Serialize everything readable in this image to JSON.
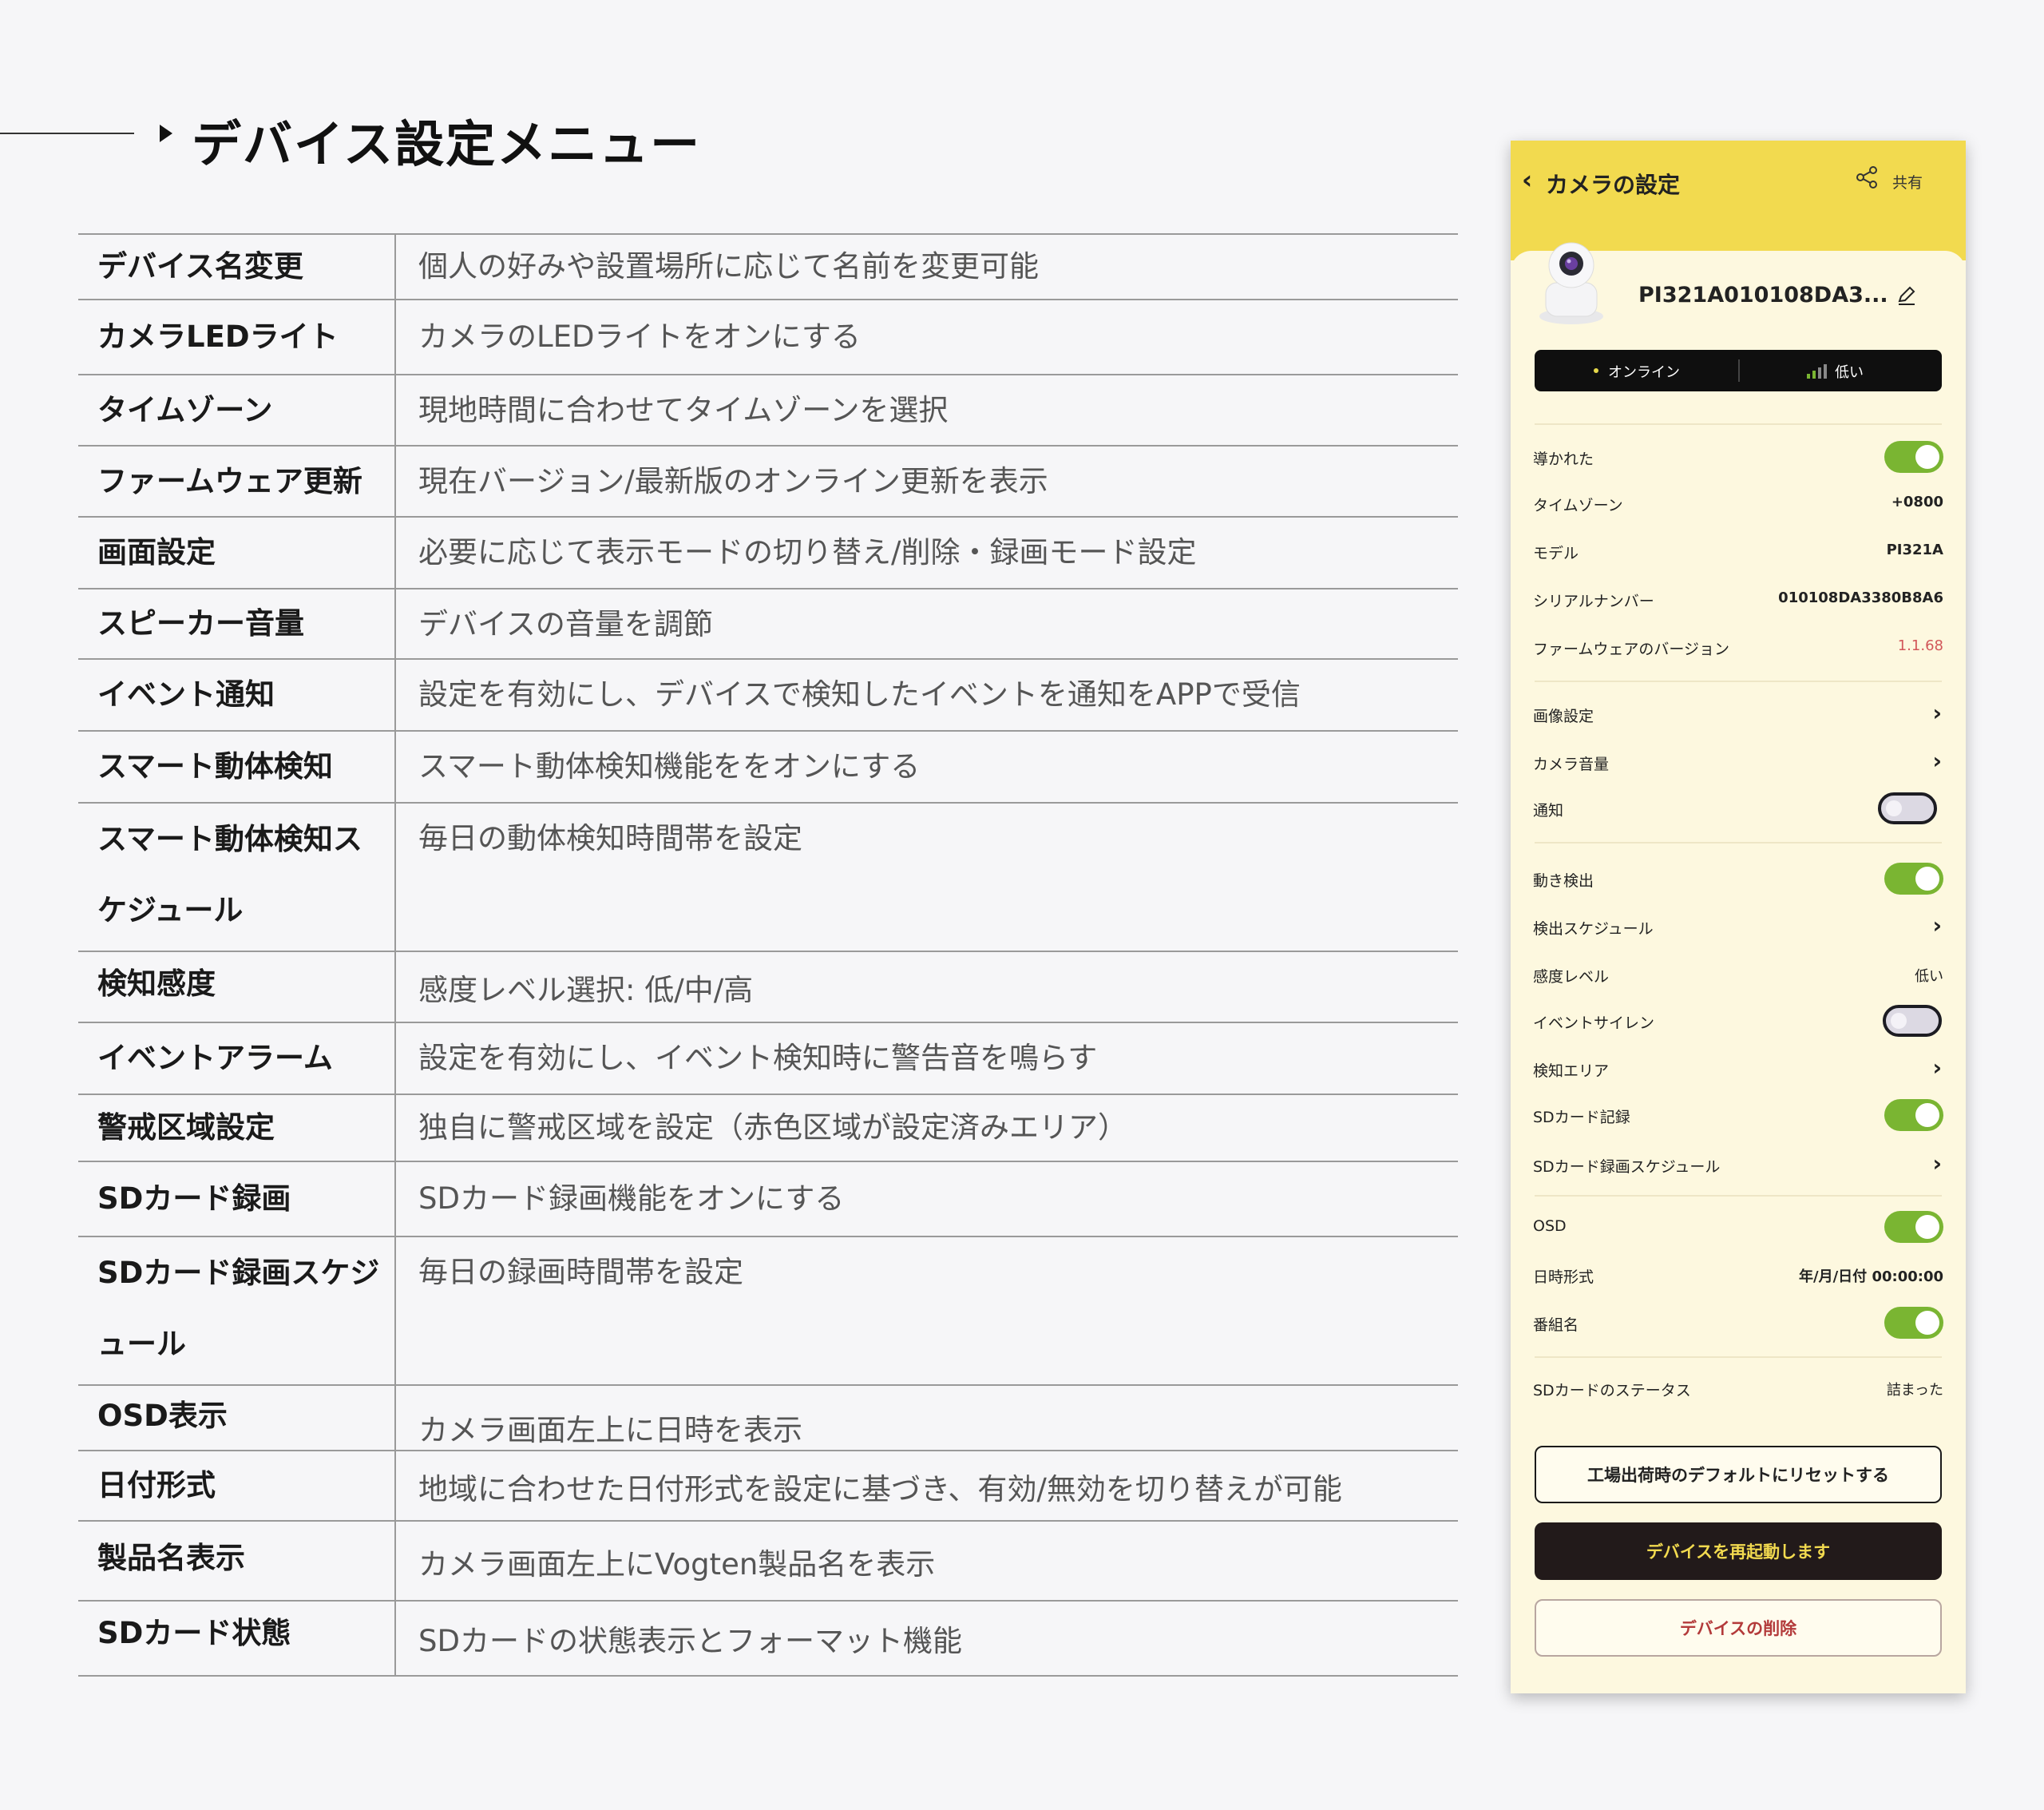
{
  "page_title": "デバイス設定メニュー",
  "table": [
    {
      "name": "デバイス名変更",
      "desc": "個人の好みや設置場所に応じて名前を変更可能"
    },
    {
      "name": "カメラLEDライト",
      "desc": "カメラのLEDライトをオンにする"
    },
    {
      "name": "タイムゾーン",
      "desc": "現地時間に合わせてタイムゾーンを選択"
    },
    {
      "name": "ファームウェア更新",
      "desc": "現在バージョン/最新版のオンライン更新を表示"
    },
    {
      "name": "画面設定",
      "desc": "必要に応じて表示モードの切り替え/削除・録画モード設定"
    },
    {
      "name": "スピーカー音量",
      "desc": "デバイスの音量を調節"
    },
    {
      "name": "イベント通知",
      "desc": "設定を有効にし、デバイスで検知したイベントを通知をAPPで受信"
    },
    {
      "name": "スマート動体検知",
      "desc": "スマート動体検知機能ををオンにする"
    },
    {
      "name_l1": "スマート動体検知ス",
      "name_l2": "ケジュール",
      "desc": "毎日の動体検知時間帯を設定"
    },
    {
      "name": "検知感度",
      "desc": "感度レベル選択: 低/中/高"
    },
    {
      "name": "イベントアラーム",
      "desc": "設定を有効にし、イベント検知時に警告音を鳴らす"
    },
    {
      "name": "警戒区域設定",
      "desc": "独自に警戒区域を設定（赤色区域が設定済みエリア）"
    },
    {
      "name": "SDカード録画",
      "desc": "SDカード録画機能をオンにする"
    },
    {
      "name_l1": "SDカード録画スケジ",
      "name_l2": "ュール",
      "desc": "毎日の録画時間帯を設定"
    },
    {
      "name": "OSD表示",
      "desc": "カメラ画面左上に日時を表示"
    },
    {
      "name": "日付形式",
      "desc": "地域に合わせた日付形式を設定に基づき、有効/無効を切り替えが可能"
    },
    {
      "name": "製品名表示",
      "desc": "カメラ画面左上にVogten製品名を表示"
    },
    {
      "name": "SDカード状態",
      "desc": "SDカードの状態表示とフォーマット機能"
    }
  ],
  "phone": {
    "title": "カメラの設定",
    "back_icon": "chevron-left-icon",
    "share_label": "共有",
    "device_name": "PI321A010108DA3...",
    "status_online": "オンライン",
    "signal_label": "低い",
    "rows": [
      {
        "label": "導かれた",
        "toggle": true
      },
      {
        "label": "タイムゾーン",
        "value": "+0800"
      },
      {
        "label": "モデル",
        "value": "PI321A"
      },
      {
        "label": "シリアルナンバー",
        "value": "010108DA3380B8A6"
      },
      {
        "label": "ファームウェアのバージョン",
        "value": "1.1.68"
      },
      {
        "label": "画像設定"
      },
      {
        "label": "カメラ音量"
      },
      {
        "label": "通知",
        "toggle": false
      },
      {
        "label": "動き検出",
        "toggle": true
      },
      {
        "label": "検出スケジュール"
      },
      {
        "label": "感度レベル",
        "value": "低い"
      },
      {
        "label": "イベントサイレン",
        "toggle": false
      },
      {
        "label": "検知エリア"
      },
      {
        "label": "SDカード記録",
        "toggle": true
      },
      {
        "label": "SDカード録画スケジュール"
      },
      {
        "label": "OSD",
        "toggle": true
      },
      {
        "label": "日時形式",
        "value": "年/月/日付 00:00:00"
      },
      {
        "label": "番組名",
        "toggle": true
      },
      {
        "label": "SDカードのステータス",
        "value": "詰まった"
      }
    ],
    "btn_reset": "工場出荷時のデフォルトにリセットする",
    "btn_reboot": "デバイスを再起動します",
    "btn_delete": "デバイスの削除",
    "colors": {
      "header": "#f2da4f",
      "toggle_on": "#7ab532",
      "firmware": "#d2575a"
    }
  }
}
